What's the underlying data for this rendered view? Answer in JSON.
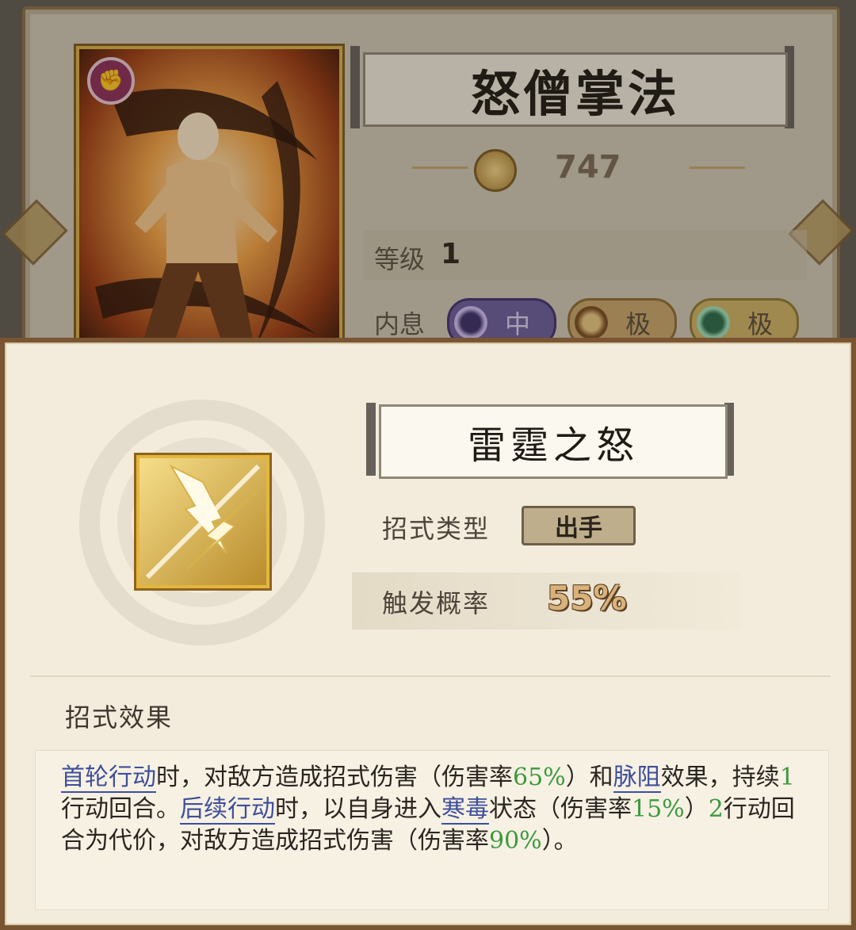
{
  "back_panel": {
    "title": "怒僧掌法",
    "power": "747",
    "level_label": "等级",
    "level_value": "1",
    "neixi_label": "内息",
    "neixi": [
      {
        "grade": "中",
        "color": "#6a5c9c"
      },
      {
        "grade": "极",
        "color": "#c7a56a"
      },
      {
        "grade": "极",
        "color": "#cdb265"
      }
    ],
    "card_badge_icon": "fist-icon"
  },
  "skill": {
    "name": "雷霆之怒",
    "type_label": "招式类型",
    "type_value": "出手",
    "prob_label": "触发概率",
    "prob_value": "55%",
    "effect_title": "招式效果",
    "effect_segments": [
      {
        "t": "首轮行动",
        "k": "kw"
      },
      {
        "t": "时，对敌方造成招式伤害（伤害率",
        "k": ""
      },
      {
        "t": "65%",
        "k": "num"
      },
      {
        "t": "）和",
        "k": ""
      },
      {
        "t": "脉阻",
        "k": "kw"
      },
      {
        "t": "效果，持续",
        "k": ""
      },
      {
        "t": "1",
        "k": "num"
      },
      {
        "t": "行动回合。",
        "k": ""
      },
      {
        "t": "后续行动",
        "k": "kw"
      },
      {
        "t": "时，以自身进入",
        "k": ""
      },
      {
        "t": "寒毒",
        "k": "kw"
      },
      {
        "t": "状态（伤害率",
        "k": ""
      },
      {
        "t": "15%",
        "k": "num"
      },
      {
        "t": "）",
        "k": ""
      },
      {
        "t": "2",
        "k": "num"
      },
      {
        "t": "行动回合为代价，对敌方造成招式伤害（伤害率",
        "k": ""
      },
      {
        "t": "90%",
        "k": "num"
      },
      {
        "t": "）。",
        "k": ""
      }
    ],
    "icon": "lightning-icon"
  }
}
